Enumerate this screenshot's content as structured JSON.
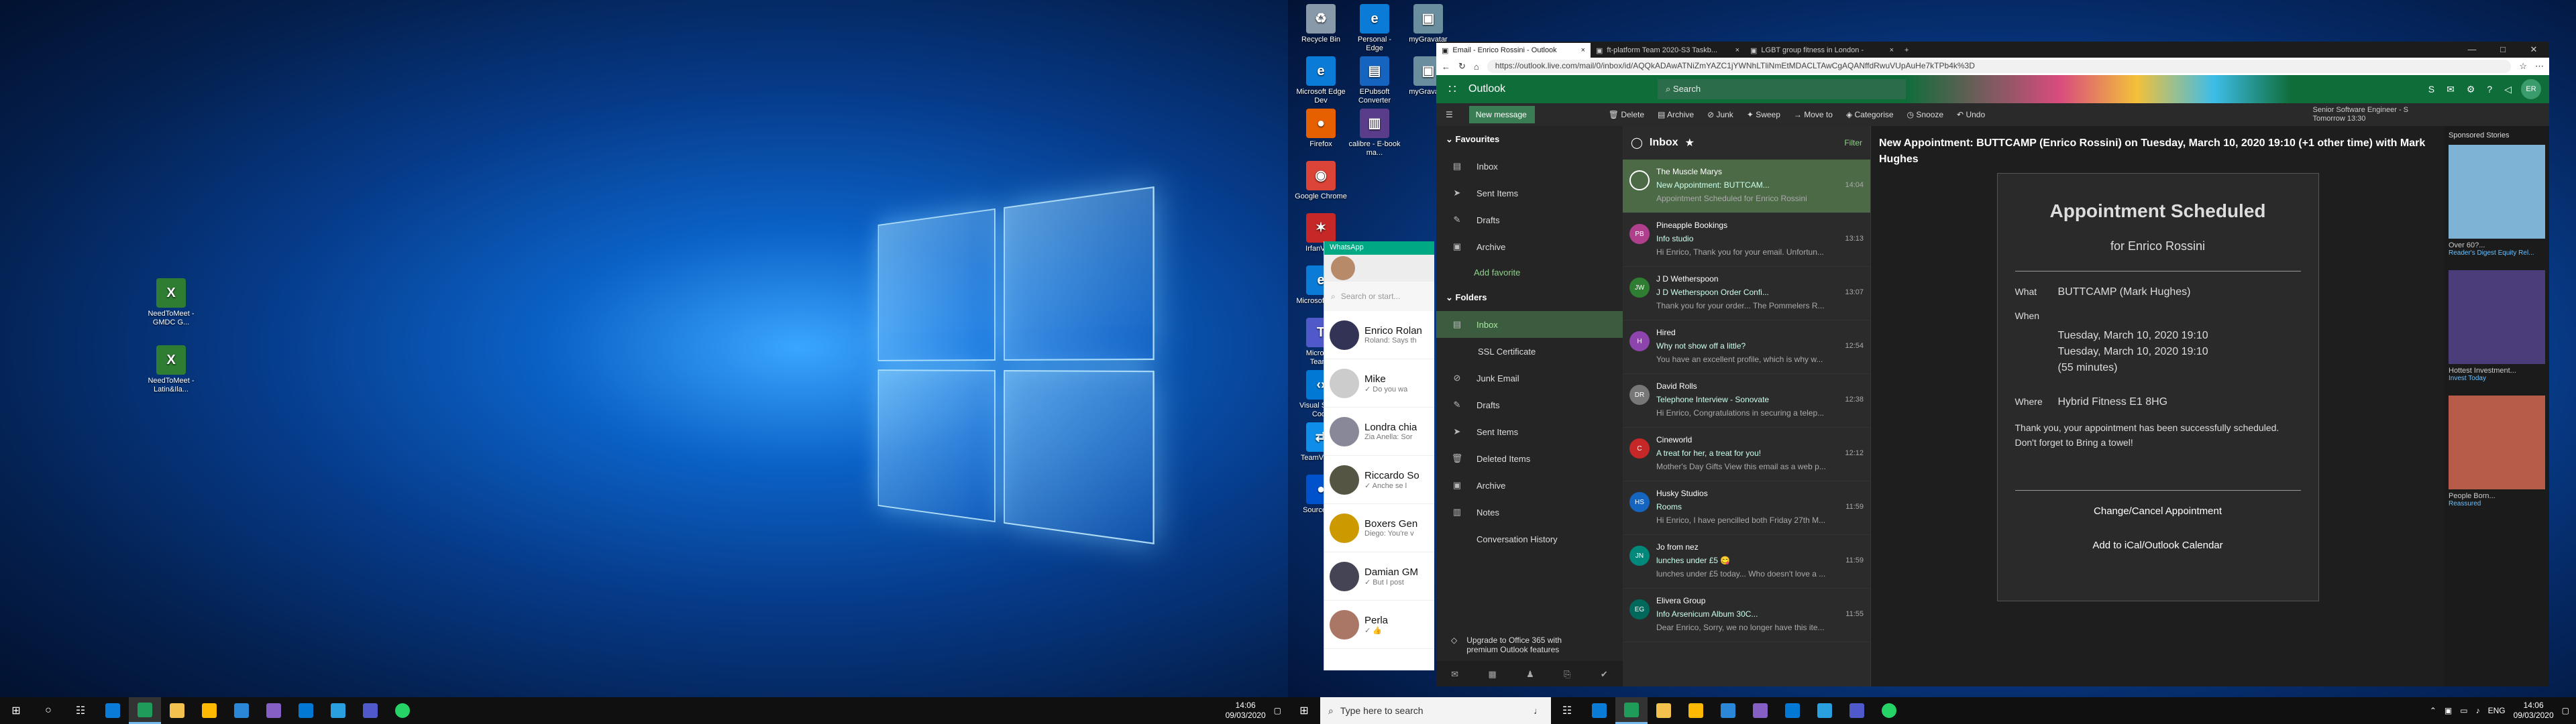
{
  "desktop_left": {
    "icons": [
      {
        "label": "NeedToMeet - GMDC G...",
        "color": "#2e7d32",
        "glyph": "X"
      },
      {
        "label": "NeedToMeet - Latin&Ila...",
        "color": "#2e7d32",
        "glyph": "X"
      }
    ]
  },
  "desktop_right": {
    "icons": [
      {
        "label": "Recycle Bin",
        "color": "#8899aa",
        "glyph": "♻"
      },
      {
        "label": "Personal - Edge",
        "color": "#0a7cd8",
        "glyph": "e"
      },
      {
        "label": "myGravatar",
        "color": "#6b8e9f",
        "glyph": "▣"
      },
      {
        "label": "Microsoft Edge Dev",
        "color": "#0a7cd8",
        "glyph": "e"
      },
      {
        "label": "EPubsoft Converter",
        "color": "#1565c0",
        "glyph": "▤"
      },
      {
        "label": "myGravatar",
        "color": "#6b8e9f",
        "glyph": "▣"
      },
      {
        "label": "Firefox",
        "color": "#e66000",
        "glyph": "●"
      },
      {
        "label": "calibre - E-book ma...",
        "color": "#5a3d8a",
        "glyph": "▥"
      },
      {
        "label": "Google Chrome",
        "color": "#db4437",
        "glyph": "◉"
      },
      {
        "label": "IrfanView",
        "color": "#c62828",
        "glyph": "✶"
      },
      {
        "label": "Microsoft Edge",
        "color": "#0a7cd8",
        "glyph": "e"
      },
      {
        "label": "Microsoft Teams",
        "color": "#5059c9",
        "glyph": "T"
      },
      {
        "label": "Visual Studio Code",
        "color": "#0078d4",
        "glyph": "‹›"
      },
      {
        "label": "TeamViewer",
        "color": "#0e8ee9",
        "glyph": "⇄"
      },
      {
        "label": "Sourcetree",
        "color": "#0052cc",
        "glyph": "●"
      }
    ]
  },
  "taskbar_left": {
    "clock_time": "14:06",
    "clock_date": "09/03/2020"
  },
  "taskbar_right": {
    "search_placeholder": "Type here to search",
    "lang": "ENG",
    "clock_time": "14:06",
    "clock_date": "09/03/2020"
  },
  "whatsapp": {
    "title": "WhatsApp",
    "search_placeholder": "Search or start...",
    "chats": [
      {
        "name": "Enrico Rolan",
        "preview": "Roland: Says th",
        "color": "#335"
      },
      {
        "name": "Mike",
        "preview": "✓ Do you wa",
        "color": "#ccc"
      },
      {
        "name": "Londra chia",
        "preview": "Zia Anella: Sor",
        "color": "#889"
      },
      {
        "name": "Riccardo So",
        "preview": "✓ Anche se l",
        "color": "#554"
      },
      {
        "name": "Boxers Gen",
        "preview": "Diego: You're v",
        "color": "#c90"
      },
      {
        "name": "Damian GM",
        "preview": "✓ But I post",
        "color": "#445"
      },
      {
        "name": "Perla",
        "preview": "✓ 👍",
        "color": "#a76"
      }
    ]
  },
  "browser": {
    "tabs": [
      {
        "label": "Email - Enrico Rossini - Outlook",
        "active": true
      },
      {
        "label": "ft-platform Team 2020-S3 Taskb...",
        "active": false
      },
      {
        "label": "LGBT group fitness in London -",
        "active": false
      }
    ],
    "url": "https://outlook.live.com/mail/0/inbox/id/AQQkADAwATNiZmYAZC1jYWNhLTliNmEtMDACLTAwCgAQANffdRwuVUpAuHe7kTPb4k%3D"
  },
  "outlook": {
    "brand": "Outlook",
    "search_placeholder": "Search",
    "user_initials": "ER",
    "new_message": "New message",
    "commands": [
      "Delete",
      "Archive",
      "Junk",
      "Sweep",
      "Move to",
      "Categorise",
      "Snooze",
      "Undo"
    ],
    "reminder_line1": "Senior Software Engineer - S",
    "reminder_line2": "Tomorrow 13:30",
    "nav": {
      "favourites_label": "Favourites",
      "favourites": [
        "Inbox",
        "Sent Items",
        "Drafts",
        "Archive"
      ],
      "add_favorite": "Add favorite",
      "folders_label": "Folders",
      "folders": [
        "Inbox",
        "SSL Certificate",
        "Junk Email",
        "Drafts",
        "Sent Items",
        "Deleted Items",
        "Archive",
        "Notes",
        "Conversation History"
      ],
      "upgrade": "Upgrade to Office 365 with premium Outlook features"
    },
    "list": {
      "title": "Inbox",
      "filter": "Filter",
      "messages": [
        {
          "from": "The Muscle Marys",
          "subject": "New Appointment: BUTTCAM...",
          "time": "14:04",
          "preview": "Appointment Scheduled for Enrico Rossini",
          "initials": "",
          "color": "#fff"
        },
        {
          "from": "Pineapple Bookings",
          "subject": "Info studio",
          "time": "13:13",
          "preview": "Hi Enrico, Thank you for your email. Unfortun...",
          "initials": "PB",
          "color": "#b0408e"
        },
        {
          "from": "J D Wetherspoon",
          "subject": "J D Wetherspoon Order Confi...",
          "time": "13:07",
          "preview": "Thank you for your order... The Pommelers R...",
          "initials": "JW",
          "color": "#2e7d32"
        },
        {
          "from": "Hired",
          "subject": "Why not show off a little?",
          "time": "12:54",
          "preview": "You have an excellent profile, which is why w...",
          "initials": "H",
          "color": "#8e44ad"
        },
        {
          "from": "David Rolls",
          "subject": "Telephone Interview - Sonovate",
          "time": "12:38",
          "preview": "Hi Enrico, Congratulations in securing a telep...",
          "initials": "DR",
          "color": "#777"
        },
        {
          "from": "Cineworld",
          "subject": "A treat for her, a treat for you!",
          "time": "12:12",
          "preview": "Mother's Day Gifts View this email as a web p...",
          "initials": "C",
          "color": "#c62828"
        },
        {
          "from": "Husky Studios",
          "subject": "Rooms",
          "time": "11:59",
          "preview": "Hi Enrico, I have pencilled both Friday 27th M...",
          "initials": "HS",
          "color": "#1565c0"
        },
        {
          "from": "Jo from nez",
          "subject": "lunches under £5 😋",
          "time": "11:59",
          "preview": "lunches under £5 today... Who doesn't love a ...",
          "initials": "JN",
          "color": "#00897b"
        },
        {
          "from": "Elivera Group",
          "subject": "Info Arsenicum Album 30C...",
          "time": "11:55",
          "preview": "Dear Enrico, Sorry, we no longer have this ite...",
          "initials": "EG",
          "color": "#00695c"
        }
      ]
    },
    "reading": {
      "subject": "New Appointment: BUTTCAMP (Enrico Rossini) on Tuesday, March 10, 2020 19:10 (+1 other time) with Mark Hughes",
      "heading": "Appointment Scheduled",
      "for_line": "for Enrico Rossini",
      "what_label": "What",
      "what_value": "BUTTCAMP (Mark Hughes)",
      "when_label": "When",
      "when_1": "Tuesday, March 10, 2020 19:10",
      "when_2": "Tuesday, March 10, 2020 19:10",
      "duration": "(55 minutes)",
      "where_label": "Where",
      "where_value": "Hybrid Fitness E1 8HG",
      "message": "Thank you, your appointment has been successfully scheduled. Don't forget to Bring a towel!",
      "link_change": "Change/Cancel Appointment",
      "link_ical": "Add to iCal/Outlook Calendar"
    },
    "ads": {
      "title": "Sponsored Stories",
      "items": [
        {
          "caption": "Over 60?...",
          "source": "Reader's Digest Equity Rel...",
          "color": "#7fb3d5"
        },
        {
          "caption": "Hottest Investment...",
          "source": "Invest Today",
          "color": "#4a3d7a"
        },
        {
          "caption": "People Born...",
          "source": "Reassured",
          "color": "#b85c4a"
        }
      ]
    }
  }
}
